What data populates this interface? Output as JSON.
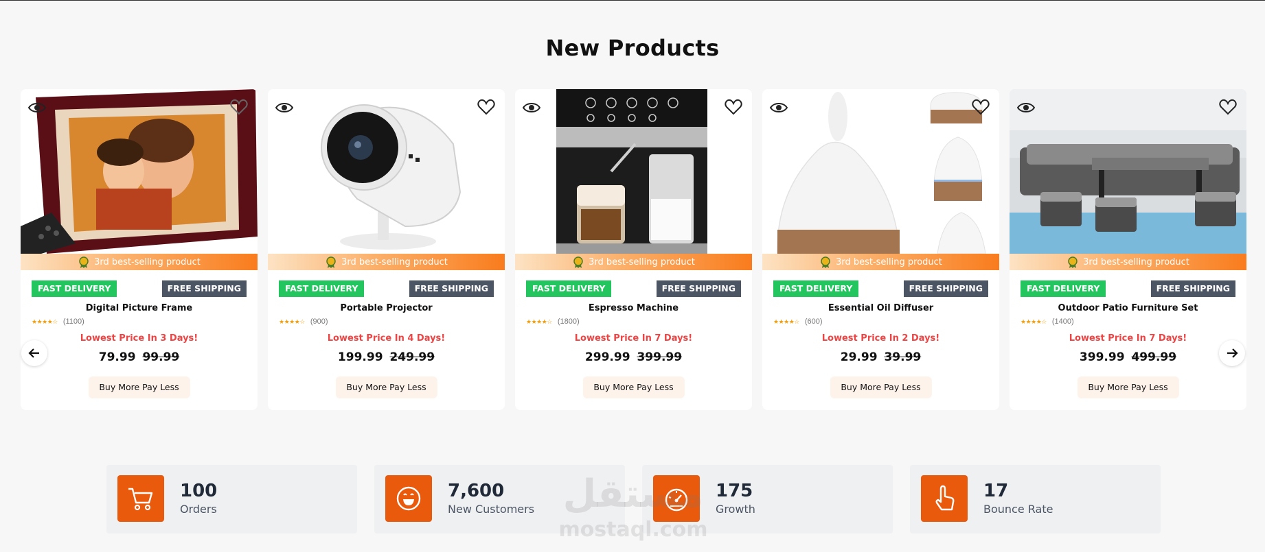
{
  "section": {
    "title": "New Products"
  },
  "products": [
    {
      "name": "Digital Picture Frame",
      "stars": "★★★★☆",
      "reviews": "(1100)",
      "best": "3rd best-selling product",
      "fast": "FAST DELIVERY",
      "free": "FREE SHIPPING",
      "promo": "Lowest Price In 3 Days!",
      "price": "79.99",
      "old_price": "99.99",
      "button": "Buy More Pay Less",
      "image_icon": "picture-frame-image"
    },
    {
      "name": "Portable Projector",
      "stars": "★★★★☆",
      "reviews": "(900)",
      "best": "3rd best-selling product",
      "fast": "FAST DELIVERY",
      "free": "FREE SHIPPING",
      "promo": "Lowest Price In 4 Days!",
      "price": "199.99",
      "old_price": "249.99",
      "button": "Buy More Pay Less",
      "image_icon": "projector-image"
    },
    {
      "name": "Espresso Machine",
      "stars": "★★★★☆",
      "reviews": "(1800)",
      "best": "3rd best-selling product",
      "fast": "FAST DELIVERY",
      "free": "FREE SHIPPING",
      "promo": "Lowest Price In 7 Days!",
      "price": "299.99",
      "old_price": "399.99",
      "button": "Buy More Pay Less",
      "image_icon": "espresso-machine-image"
    },
    {
      "name": "Essential Oil Diffuser",
      "stars": "★★★★☆",
      "reviews": "(600)",
      "best": "3rd best-selling product",
      "fast": "FAST DELIVERY",
      "free": "FREE SHIPPING",
      "promo": "Lowest Price In 2 Days!",
      "price": "29.99",
      "old_price": "39.99",
      "button": "Buy More Pay Less",
      "image_icon": "oil-diffuser-image"
    },
    {
      "name": "Outdoor Patio Furniture Set",
      "stars": "★★★★☆",
      "reviews": "(1400)",
      "best": "3rd best-selling product",
      "fast": "FAST DELIVERY",
      "free": "FREE SHIPPING",
      "promo": "Lowest Price In 7 Days!",
      "price": "399.99",
      "old_price": "499.99",
      "button": "Buy More Pay Less",
      "image_icon": "patio-furniture-image"
    }
  ],
  "stats": [
    {
      "value": "100",
      "label": "Orders",
      "icon": "cart-icon"
    },
    {
      "value": "7,600",
      "label": "New Customers",
      "icon": "smile-icon"
    },
    {
      "value": "175",
      "label": "Growth",
      "icon": "speedometer-icon"
    },
    {
      "value": "17",
      "label": "Bounce Rate",
      "icon": "pointer-hand-icon"
    }
  ],
  "watermark": {
    "arabic": "مستقل",
    "latin": "mostaql.com"
  },
  "colors": {
    "accent": "#ea5a0c",
    "fast_badge": "#22c55e",
    "free_badge": "#4b5563",
    "promo": "#ef4444",
    "button_bg": "#fdf3ea"
  }
}
